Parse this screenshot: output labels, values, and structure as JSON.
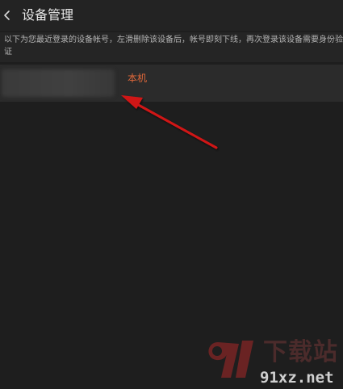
{
  "header": {
    "back_icon": "chevron-left-icon",
    "title": "设备管理"
  },
  "info": {
    "text": "以下为您最近登录的设备帐号，左滑删除该设备后，帐号即刻下线，再次登录该设备需要身份验证"
  },
  "devices": [
    {
      "name_hidden": true,
      "tag": "本机"
    }
  ],
  "watermark": {
    "cn": "下载站",
    "en": "91xz.net"
  },
  "colors": {
    "background": "#1e1e1e",
    "row": "#2b2b2b",
    "tag_accent": "#e0683a",
    "annotation_arrow": "#d01818"
  }
}
